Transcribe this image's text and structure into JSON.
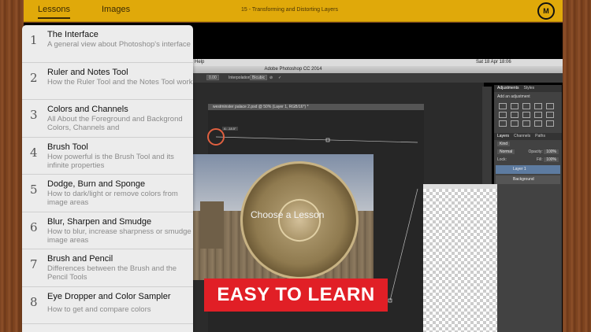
{
  "nav": {
    "tabs": [
      {
        "label": "Lessons",
        "active": true
      },
      {
        "label": "Images",
        "active": false
      }
    ],
    "title": "15 - Transforming and Distorting Layers",
    "logo_icon": "app-logo-icon"
  },
  "photoshop": {
    "menu_help": "Help",
    "clock": "Sat 18 Apr  18:06",
    "app_title": "Adobe Photoshop CC 2014",
    "options": {
      "angle": "0.00",
      "interpolation_label": "Interpolation:",
      "interpolation_value": "Bicubic"
    },
    "document_tab": "westminster palace 2.psd @ 50% (Layer 1, RGB/16*) *",
    "rotation_readout": "A: -18.5°",
    "photo_caption": "Choose a Lesson",
    "panels": {
      "tabs_top": [
        "Adjustments",
        "Styles"
      ],
      "add_adjustment": "Add an adjustment",
      "tabs_layers": [
        "Layers",
        "Channels",
        "Paths"
      ],
      "kind": "Kind",
      "blend_mode": "Normal",
      "opacity_label": "Opacity:",
      "opacity_value": "100%",
      "lock_label": "Lock:",
      "fill_label": "Fill:",
      "fill_value": "100%",
      "layers": [
        {
          "name": "Layer 1",
          "selected": true
        },
        {
          "name": "Background",
          "selected": false
        }
      ]
    }
  },
  "lessons": [
    {
      "number": "1",
      "title": "The Interface",
      "description": "A general view about Photoshop's interface"
    },
    {
      "number": "2",
      "title": "Ruler and Notes Tool",
      "description": "How the Ruler Tool and the Notes Tool work"
    },
    {
      "number": "3",
      "title": "Colors and Channels",
      "description": "All About the Foreground and Backgrond Colors, Channels and"
    },
    {
      "number": "4",
      "title": "Brush Tool",
      "description": "How powerful is the Brush Tool and its infinite properties"
    },
    {
      "number": "5",
      "title": "Dodge, Burn and Sponge",
      "description": "How to dark/light or remove colors from image areas"
    },
    {
      "number": "6",
      "title": "Blur, Sharpen and Smudge",
      "description": "How to blur, increase sharpness or smudge image areas"
    },
    {
      "number": "7",
      "title": "Brush and Pencil",
      "description": "Differences between the Brush and the Pencil Tools"
    },
    {
      "number": "8",
      "title": "Eye Dropper and Color Sampler",
      "description": "How to get and compare colors"
    }
  ],
  "banner": {
    "text": "EASY TO LEARN",
    "color": "#e11f26"
  },
  "colors": {
    "topbar": "#e0a90a",
    "wood": "#7a4220",
    "list_bg": "#ececec"
  }
}
